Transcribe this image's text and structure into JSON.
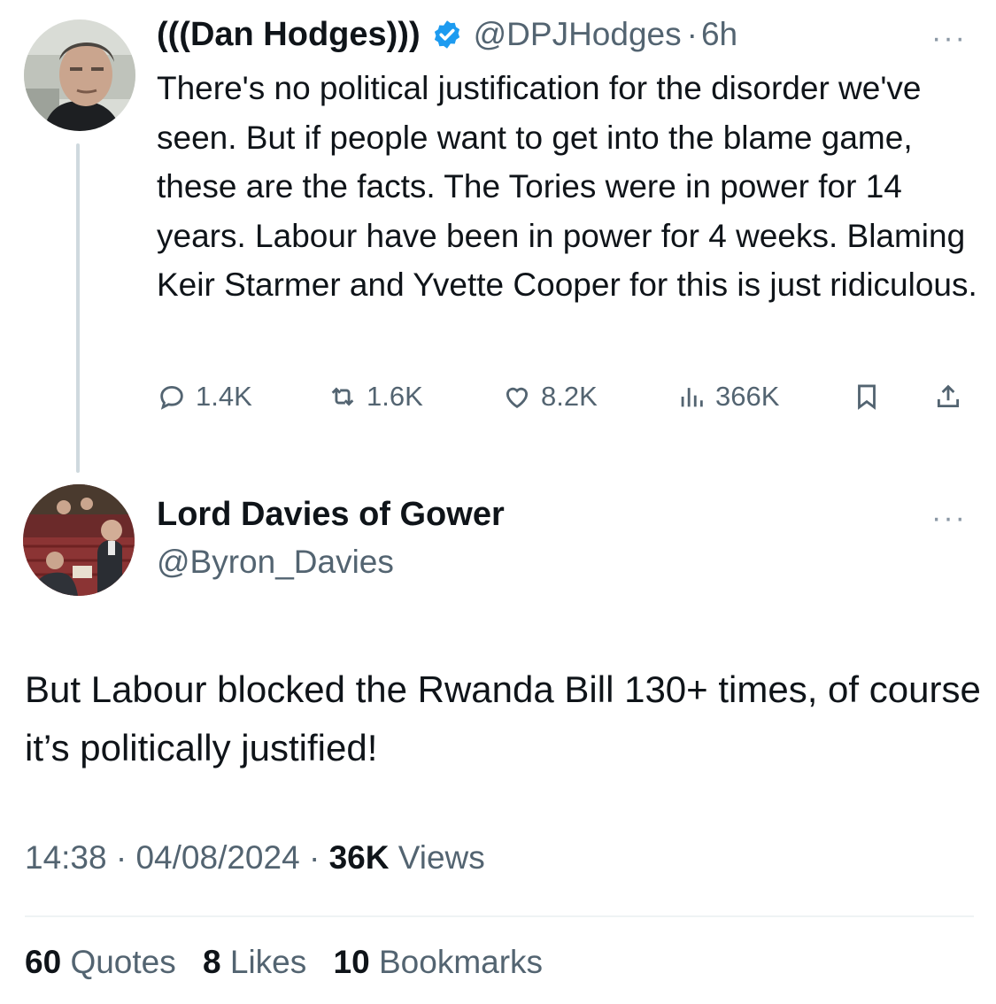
{
  "parent_tweet": {
    "display_name": "(((Dan Hodges)))",
    "handle": "@DPJHodges",
    "separator": "·",
    "time": "6h",
    "more": "···",
    "text": "There's no political justification for the disorder we've seen. But if people want to get into the blame game, these are the facts. The Tories were in power for 14 years. Labour have been in power for 4 weeks. Blaming Keir Starmer and Yvette Cooper for this is just ridiculous.",
    "actions": {
      "replies": "1.4K",
      "reposts": "1.6K",
      "likes": "8.2K",
      "views": "366K"
    },
    "verified_color": "#1d9bf0"
  },
  "reply_tweet": {
    "display_name": "Lord Davies of Gower",
    "handle": "@Byron_Davies",
    "more": "···",
    "text": "But Labour blocked the Rwanda Bill 130+ times, of course it’s politically justified!",
    "time": "14:38",
    "date": "04/08/2024",
    "dot": "·",
    "views_count": "36K",
    "views_label": "Views",
    "stats": {
      "quotes_count": "60",
      "quotes_label": "Quotes",
      "likes_count": "8",
      "likes_label": "Likes",
      "bookmarks_count": "10",
      "bookmarks_label": "Bookmarks"
    }
  },
  "icons": [
    "verified-badge-icon",
    "reply-icon",
    "repost-icon",
    "like-icon",
    "views-icon",
    "bookmark-icon",
    "share-icon",
    "more-icon"
  ]
}
